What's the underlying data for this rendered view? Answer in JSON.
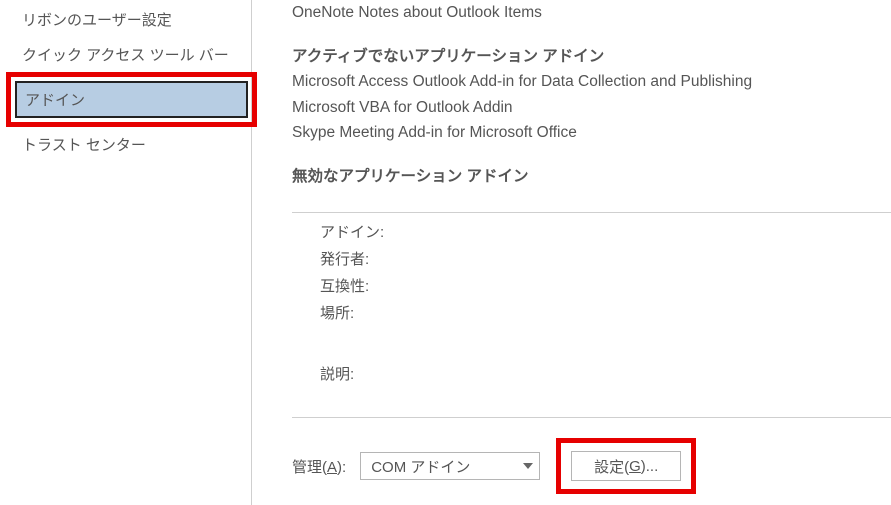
{
  "sidebar": {
    "items": [
      {
        "label": "リボンのユーザー設定"
      },
      {
        "label": "クイック アクセス ツール バー"
      },
      {
        "label": "アドイン"
      },
      {
        "label": "トラスト センター"
      }
    ]
  },
  "addins": {
    "top_partial": "OneNote Notes about Outlook Items",
    "inactive_heading": "アクティブでないアプリケーション アドイン",
    "inactive_items": [
      "Microsoft Access Outlook Add-in for Data Collection and Publishing",
      "Microsoft VBA for Outlook Addin",
      "Skype Meeting Add-in for Microsoft Office"
    ],
    "disabled_heading": "無効なアプリケーション アドイン"
  },
  "details": {
    "addin_label": "アドイン:",
    "publisher_label": "発行者:",
    "compat_label": "互換性:",
    "location_label": "場所:",
    "desc_label": "説明:"
  },
  "manage": {
    "label_prefix": "管理(",
    "label_key": "A",
    "label_suffix": "):",
    "combo_value": "COM アドイン",
    "go_prefix": "設定(",
    "go_key": "G",
    "go_suffix": ")..."
  }
}
